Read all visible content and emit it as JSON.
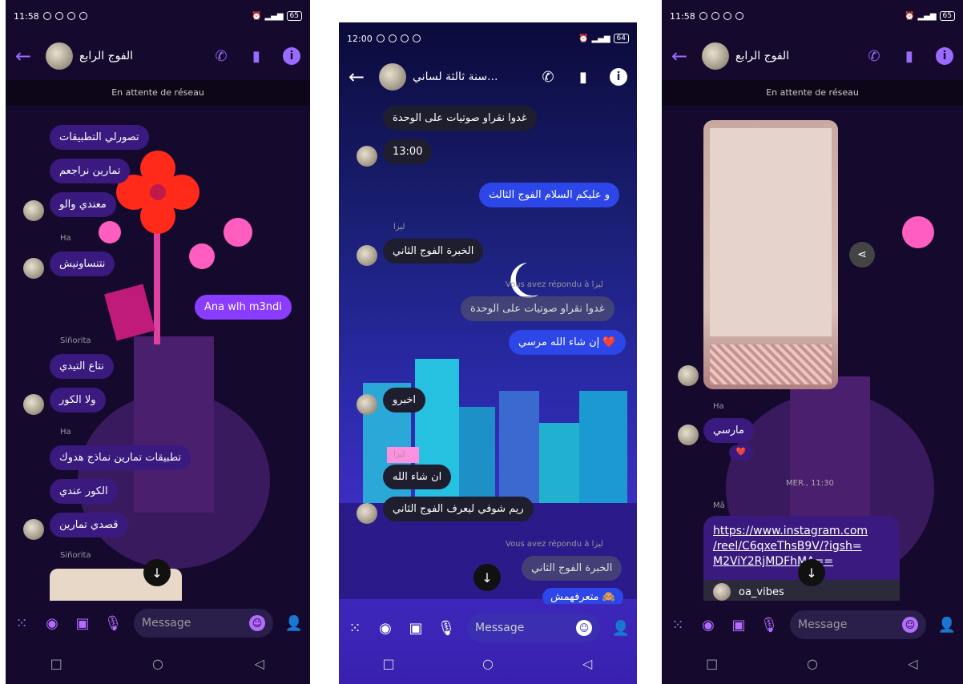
{
  "p1": {
    "time": "11:58",
    "battery": "65",
    "title": "الفوج الرابع",
    "network": "En attente de réseau",
    "bubbles": [
      "تصورلي التطبيقات",
      "تمارين نراجعم",
      "معندي والو",
      "نتنساونيش",
      "Ana wlh m3ndi",
      "نتاع التيدي",
      "ولا الكور",
      "تطبيقات تمارين نماذج هدوك",
      "الكور عندي",
      "قصدي تمارين"
    ],
    "labels": [
      "Ha",
      "Siñorita",
      "Ha",
      "Siñorita"
    ],
    "placeholder": "Message"
  },
  "p2": {
    "time": "12:00",
    "battery": "64",
    "title": "سنة ثالثة لساني...",
    "bubbles": [
      "غدوا نقراو صوتيات على الوحدة",
      "13:00",
      "و عليكم السلام الفوج الثالث",
      "الخبرة الفوج الثاني",
      "غدوا نقراو صوتيات على الوحدة",
      "إن شاء الله مرسي ❤️",
      "اخبرو",
      "ان شاء الله",
      "ريم شوفي ليعرف الفوج الثاني",
      "الخبرة الفوج الثاني",
      "متعرفهمش 🙈"
    ],
    "labels": [
      "ليزا",
      "Vous avez répondu à ليزا",
      "ليزا",
      "Vous avez répondu à ليزا"
    ],
    "placeholder": "Message"
  },
  "p3": {
    "time": "11:58",
    "battery": "65",
    "title": "الفوج الرابع",
    "network": "En attente de réseau",
    "labels": [
      "Ha",
      "MER., 11:30",
      "Mâ"
    ],
    "bubble": "مارسي",
    "reaction": "❤️",
    "link": "https://www.instagram.com/reel/C6qxeThsB9V/?igsh=M2ViY2RjMDFhMA==",
    "link_display": [
      "https://www.instagram.com",
      "/reel/C6qxeThsB9V/?igsh=",
      "M2ViY2RjMDFhMA=="
    ],
    "preview_name": "oa_vibes",
    "placeholder": "Message"
  },
  "colors": {
    "accent": "#9a6bff",
    "bubble": "#3a1a7e",
    "me": "#8a3cff"
  },
  "icons": {
    "back": "←",
    "phone": "✆",
    "video": "▮",
    "info": "i",
    "apps": "⁙",
    "camera": "◉",
    "image": "▣",
    "mic": "🎙",
    "emoji": "☺",
    "square": "□",
    "circle": "○",
    "triangle": "◁",
    "down": "↓"
  }
}
